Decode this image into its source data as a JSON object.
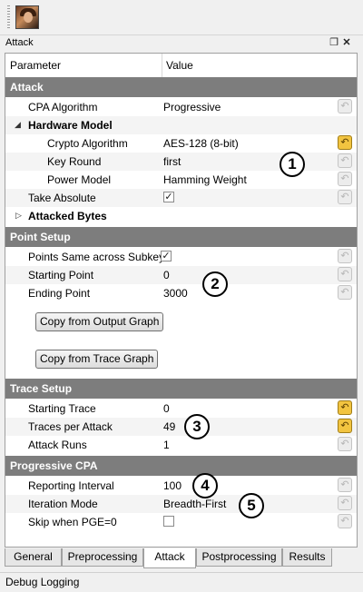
{
  "dock": {
    "title": "Attack"
  },
  "header": {
    "parameter": "Parameter",
    "value": "Value"
  },
  "sections": {
    "attack": "Attack",
    "point_setup": "Point Setup",
    "trace_setup": "Trace Setup",
    "progressive_cpa": "Progressive CPA"
  },
  "attack": {
    "cpa_algorithm": {
      "label": "CPA Algorithm",
      "value": "Progressive"
    },
    "hardware_model": "Hardware Model",
    "crypto_algorithm": {
      "label": "Crypto Algorithm",
      "value": "AES-128 (8-bit)"
    },
    "key_round": {
      "label": "Key Round",
      "value": "first"
    },
    "power_model": {
      "label": "Power Model",
      "value": "Hamming Weight"
    },
    "take_absolute": {
      "label": "Take Absolute",
      "checked": true
    },
    "attacked_bytes": "Attacked Bytes"
  },
  "point_setup": {
    "same_across": {
      "label": "Points Same across Subkeys",
      "checked": true
    },
    "starting_point": {
      "label": "Starting Point",
      "value": "0"
    },
    "ending_point": {
      "label": "Ending Point",
      "value": "3000"
    },
    "copy_output": "Copy from Output Graph",
    "copy_trace": "Copy from Trace Graph"
  },
  "trace_setup": {
    "starting_trace": {
      "label": "Starting Trace",
      "value": "0"
    },
    "traces_per_attack": {
      "label": "Traces per Attack",
      "value": "49"
    },
    "attack_runs": {
      "label": "Attack Runs",
      "value": "1"
    }
  },
  "progressive_cpa": {
    "reporting_interval": {
      "label": "Reporting Interval",
      "value": "100"
    },
    "iteration_mode": {
      "label": "Iteration Mode",
      "value": "Breadth-First"
    },
    "skip_pge": {
      "label": "Skip when PGE=0",
      "checked": false
    }
  },
  "annotations": [
    "1",
    "2",
    "3",
    "4",
    "5"
  ],
  "tabs": [
    "General",
    "Preprocessing",
    "Attack",
    "Postprocessing",
    "Results"
  ],
  "active_tab": "Attack",
  "status": {
    "debug": "Debug Logging"
  },
  "colors": {
    "section_bg": "#7d7d7d",
    "reset_active": "#f2c440"
  }
}
